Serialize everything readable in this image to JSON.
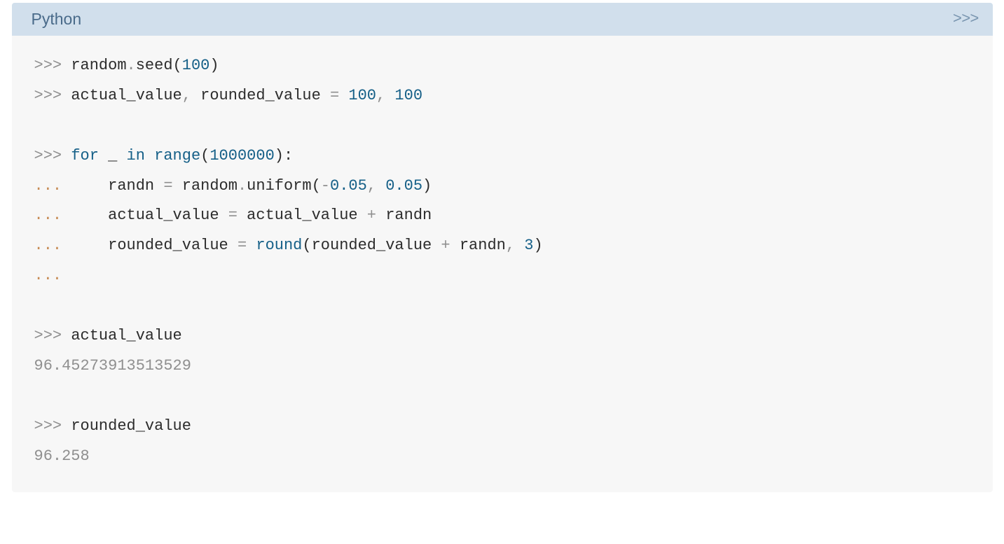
{
  "header": {
    "title": "Python",
    "icon": ">>>"
  },
  "code": {
    "line1_prompt": ">>> ",
    "line1_ident1": "random",
    "line1_dot": ".",
    "line1_method1": "seed",
    "line1_paren_open": "(",
    "line1_num": "100",
    "line1_paren_close": ")",
    "line2_prompt": ">>> ",
    "line2_ident1": "actual_value",
    "line2_comma1": ", ",
    "line2_ident2": "rounded_value",
    "line2_eq": " = ",
    "line2_num1": "100",
    "line2_comma2": ", ",
    "line2_num2": "100",
    "line3": " ",
    "line4_prompt": ">>> ",
    "line4_for": "for",
    "line4_sp1": " ",
    "line4_var": "_",
    "line4_sp2": " ",
    "line4_in": "in",
    "line4_sp3": " ",
    "line4_range": "range",
    "line4_paren_open": "(",
    "line4_num": "1000000",
    "line4_paren_close": ")",
    "line4_colon": ":",
    "line5_cont": "... ",
    "line5_indent": "    ",
    "line5_var": "randn",
    "line5_eq": " = ",
    "line5_random": "random",
    "line5_dot": ".",
    "line5_uniform": "uniform",
    "line5_paren_open": "(",
    "line5_neg": "-",
    "line5_num1": "0.05",
    "line5_comma": ", ",
    "line5_num2": "0.05",
    "line5_paren_close": ")",
    "line6_cont": "... ",
    "line6_indent": "    ",
    "line6_var": "actual_value",
    "line6_eq": " = ",
    "line6_var2": "actual_value",
    "line6_plus": " + ",
    "line6_var3": "randn",
    "line7_cont": "... ",
    "line7_indent": "    ",
    "line7_var": "rounded_value",
    "line7_eq": " = ",
    "line7_round": "round",
    "line7_paren_open": "(",
    "line7_var2": "rounded_value",
    "line7_plus": " + ",
    "line7_var3": "randn",
    "line7_comma": ", ",
    "line7_num": "3",
    "line7_paren_close": ")",
    "line8_cont": "...",
    "line9": " ",
    "line10_prompt": ">>> ",
    "line10_var": "actual_value",
    "line11_output": "96.45273913513529",
    "line12": " ",
    "line13_prompt": ">>> ",
    "line13_var": "rounded_value",
    "line14_output": "96.258"
  }
}
